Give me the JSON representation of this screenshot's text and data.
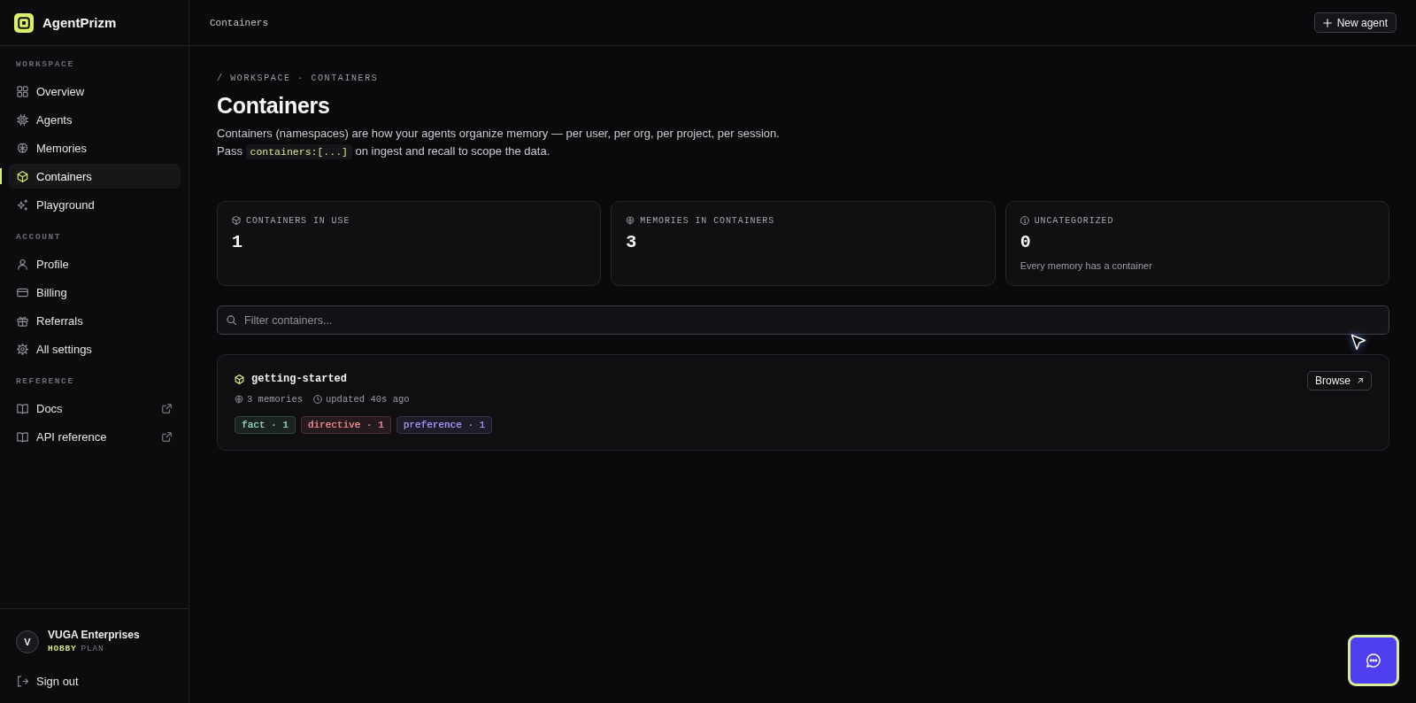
{
  "brand": {
    "name": "AgentPrizm"
  },
  "sidebar": {
    "sections": [
      {
        "title": "WORKSPACE",
        "items": [
          {
            "label": "Overview",
            "selected": false,
            "external": false
          },
          {
            "label": "Agents",
            "selected": false,
            "external": false
          },
          {
            "label": "Memories",
            "selected": false,
            "external": false
          },
          {
            "label": "Containers",
            "selected": true,
            "external": false
          },
          {
            "label": "Playground",
            "selected": false,
            "external": false
          }
        ]
      },
      {
        "title": "ACCOUNT",
        "items": [
          {
            "label": "Profile",
            "selected": false,
            "external": false
          },
          {
            "label": "Billing",
            "selected": false,
            "external": false
          },
          {
            "label": "Referrals",
            "selected": false,
            "external": false
          },
          {
            "label": "All settings",
            "selected": false,
            "external": false
          }
        ]
      },
      {
        "title": "REFERENCE",
        "items": [
          {
            "label": "Docs",
            "selected": false,
            "external": true
          },
          {
            "label": "API reference",
            "selected": false,
            "external": true
          }
        ]
      }
    ]
  },
  "account": {
    "initial": "V",
    "name": "VUGA Enterprises",
    "plan": "HOBBY",
    "plan_label": "PLAN"
  },
  "sign_out": {
    "label": "Sign out"
  },
  "topbar": {
    "title": "Containers",
    "action": "New agent"
  },
  "page": {
    "breadcrumb": "/ WORKSPACE · CONTAINERS",
    "title": "Containers",
    "description": "Containers (namespaces) are how your agents organize memory — per user, per org, per project, per session.",
    "usage": {
      "before": "Pass",
      "code": "containers:[...]",
      "after": "on ingest and recall to scope the data."
    }
  },
  "stats": [
    {
      "label": "CONTAINERS IN USE",
      "value": "1"
    },
    {
      "label": "MEMORIES IN CONTAINERS",
      "value": "3"
    },
    {
      "label": "UNCATEGORIZED",
      "value": "0",
      "note": "Every memory has a container"
    }
  ],
  "filter": {
    "placeholder": "Filter containers..."
  },
  "containers": [
    {
      "name": "getting-started",
      "memories": "3 memories",
      "updated": "updated 40s ago",
      "action": "Browse",
      "tags": [
        {
          "label": "fact · 1",
          "color": "#8fd6b4"
        },
        {
          "label": "directive · 1",
          "color": "#e5868b"
        },
        {
          "label": "preference · 1",
          "color": "#a193f2"
        }
      ]
    }
  ]
}
